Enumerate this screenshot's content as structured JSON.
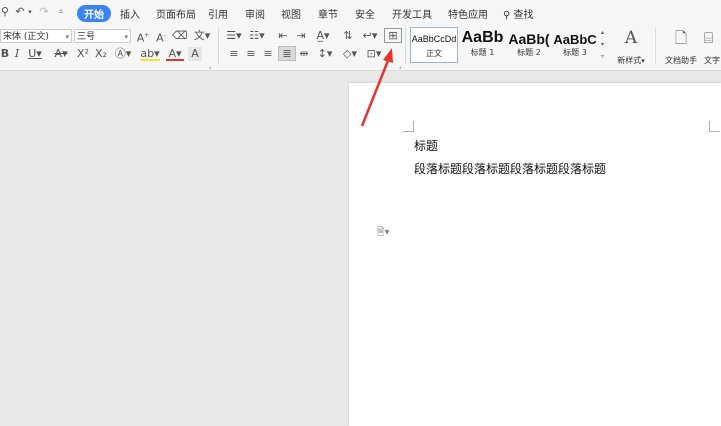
{
  "menu": {
    "tabs": [
      "开始",
      "插入",
      "页面布局",
      "引用",
      "审阅",
      "视图",
      "章节",
      "安全",
      "开发工具",
      "特色应用"
    ],
    "active_tab": "开始",
    "search_label": "查找"
  },
  "toolbar": {
    "font_name": "宋体 (正文)",
    "font_size": "三号"
  },
  "styles": {
    "items": [
      {
        "sample": "AaBbCcDd",
        "label": "正文"
      },
      {
        "sample": "AaBb",
        "label": "标题 1"
      },
      {
        "sample": "AaBb(",
        "label": "标题 2"
      },
      {
        "sample": "AaBbC",
        "label": "标题 3"
      }
    ],
    "new_style_label": "新样式",
    "doc_helper_label": "文档助手",
    "text_tool_label": "文字"
  },
  "document": {
    "heading": "标题",
    "paragraph": "段落标题段落标题段落标题段落标题"
  },
  "colors": {
    "accent": "#3b82f6",
    "arrow": "#e8322f"
  }
}
